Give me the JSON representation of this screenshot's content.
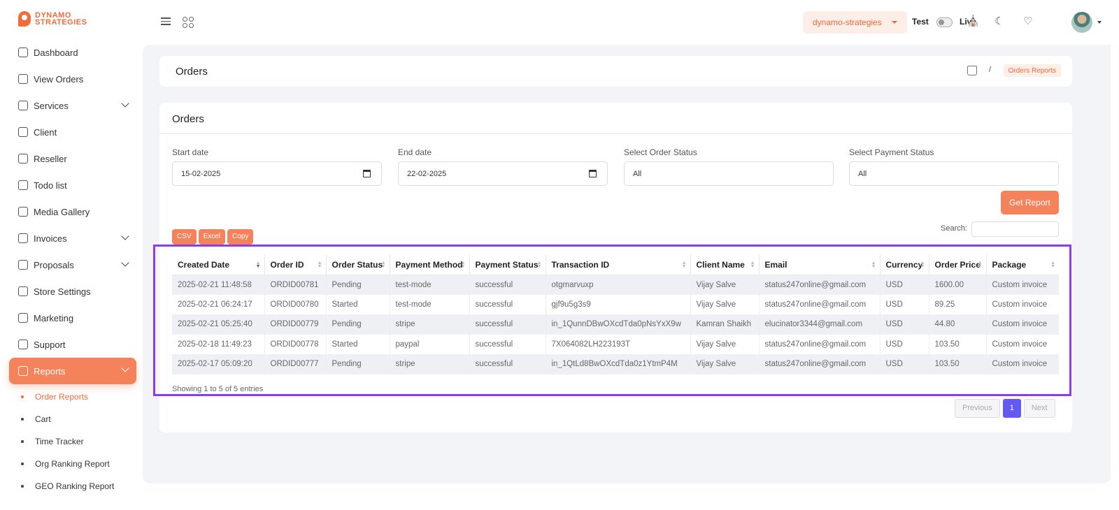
{
  "brand": {
    "line1": "DYNAMO",
    "line2": "STRATEGIES"
  },
  "sidebar": {
    "items": [
      {
        "label": "Dashboard",
        "icon": "dashboard-icon"
      },
      {
        "label": "View Orders",
        "icon": "basket-icon"
      },
      {
        "label": "Services",
        "icon": "services-icon",
        "expandable": true
      },
      {
        "label": "Client",
        "icon": "client-icon"
      },
      {
        "label": "Reseller",
        "icon": "reseller-icon"
      },
      {
        "label": "Todo list",
        "icon": "todo-icon"
      },
      {
        "label": "Media Gallery",
        "icon": "gallery-icon"
      },
      {
        "label": "Invoices",
        "icon": "invoice-icon",
        "expandable": true
      },
      {
        "label": "Proposals",
        "icon": "proposal-icon",
        "expandable": true
      },
      {
        "label": "Store Settings",
        "icon": "store-icon"
      },
      {
        "label": "Marketing",
        "icon": "megaphone-icon"
      },
      {
        "label": "Support",
        "icon": "support-icon"
      },
      {
        "label": "Reports",
        "icon": "report-icon",
        "expandable": true,
        "active": true
      }
    ],
    "subitems": [
      {
        "label": "Order Reports",
        "active": true
      },
      {
        "label": "Cart"
      },
      {
        "label": "Time Tracker"
      },
      {
        "label": "Org Ranking Report"
      },
      {
        "label": "GEO Ranking Report"
      }
    ]
  },
  "header": {
    "store": "dynamo-strategies",
    "mode_test": "Test",
    "mode_live": "Live",
    "live_enabled": false
  },
  "page": {
    "title": "Orders",
    "breadcrumb_current": "Orders Reports"
  },
  "card": {
    "title": "Orders",
    "filters": {
      "start_label": "Start date",
      "start_value": "15-02-2025",
      "end_label": "End date",
      "end_value": "22-02-2025",
      "order_status_label": "Select Order Status",
      "order_status_value": "All",
      "payment_status_label": "Select Payment Status",
      "payment_status_value": "All"
    },
    "get_report": "Get Report",
    "export": {
      "csv": "CSV",
      "excel": "Excel",
      "copy": "Copy"
    },
    "search_label": "Search:"
  },
  "table": {
    "columns": [
      "Created Date",
      "Order ID",
      "Order Status",
      "Payment Method",
      "Payment Status",
      "Transaction ID",
      "Client Name",
      "Email",
      "Currency",
      "Order Price",
      "Package"
    ],
    "rows": [
      [
        "2025-02-21 11:48:58",
        "ORDID00781",
        "Pending",
        "test-mode",
        "successful",
        "otgmarvuxp",
        "Vijay Salve",
        "status247online@gmail.com",
        "USD",
        "1600.00",
        "Custom invoice"
      ],
      [
        "2025-02-21 06:24:17",
        "ORDID00780",
        "Started",
        "test-mode",
        "successful",
        "gjf9u5g3s9",
        "Vijay Salve",
        "status247online@gmail.com",
        "USD",
        "89.25",
        "Custom invoice"
      ],
      [
        "2025-02-21 05:25:40",
        "ORDID00779",
        "Pending",
        "stripe",
        "successful",
        "in_1QunnDBwOXcdTda0pNsYxX9w",
        "Kamran Shaikh",
        "elucinator3344@gmail.com",
        "USD",
        "44.80",
        "Custom invoice"
      ],
      [
        "2025-02-18 11:49:23",
        "ORDID00778",
        "Started",
        "paypal",
        "successful",
        "7X064082LH223193T",
        "Vijay Salve",
        "status247online@gmail.com",
        "USD",
        "103.50",
        "Custom invoice"
      ],
      [
        "2025-02-17 05:09:20",
        "ORDID00777",
        "Pending",
        "stripe",
        "successful",
        "in_1QtLd8BwOXcdTda0z1YtmP4M",
        "Vijay Salve",
        "status247online@gmail.com",
        "USD",
        "103.50",
        "Custom invoice"
      ]
    ],
    "entries_info": "Showing 1 to 5 of 5 entries",
    "pagination": {
      "previous": "Previous",
      "current": "1",
      "next": "Next"
    }
  },
  "colors": {
    "accent": "#f4825a",
    "brand": "#f26b3a",
    "page_active": "#6359f5",
    "highlight": "#8a3cf0"
  }
}
